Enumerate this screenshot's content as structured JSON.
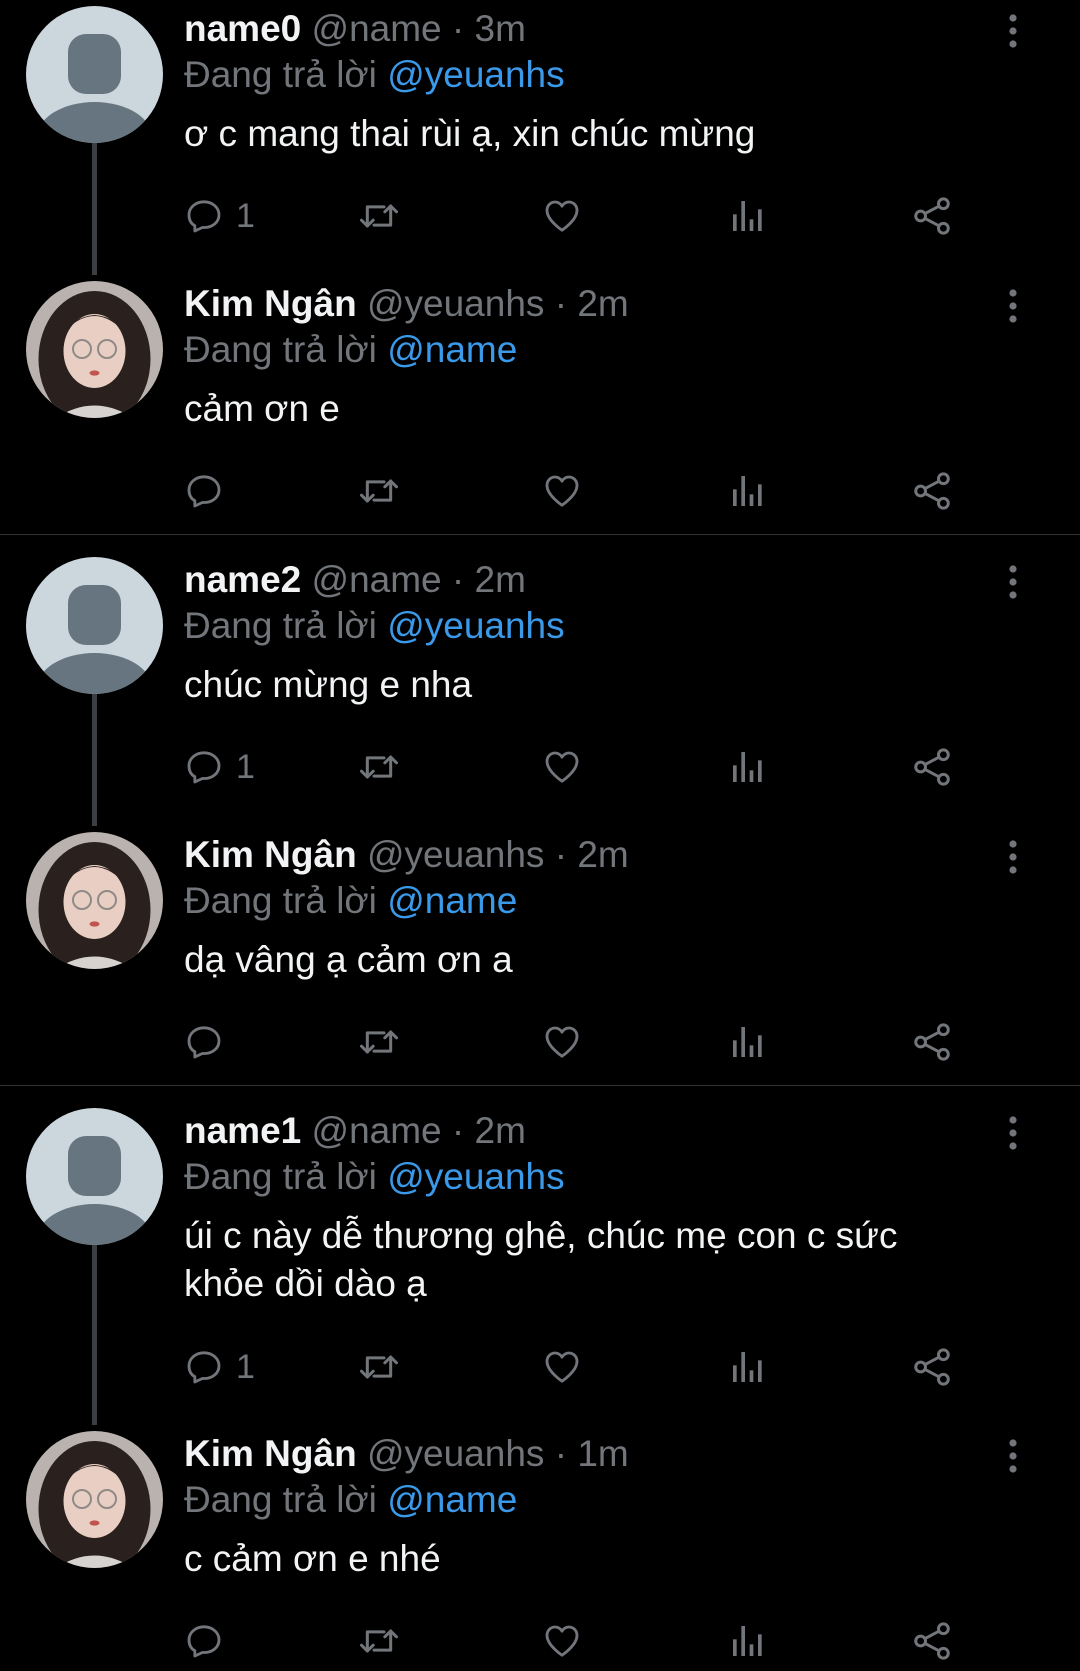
{
  "colors": {
    "background": "#000000",
    "mention": "#3a99e8",
    "muted": "#72767b",
    "divider": "#2f3336"
  },
  "labels": {
    "replying_to": "Đang trả lời"
  },
  "tweets": [
    {
      "name": "name0",
      "handle": "@name",
      "time": "3m",
      "reply_to": "@yeuanhs",
      "text": "ơ c mang thai rùi ạ, xin chúc mừng",
      "reply_count": "1",
      "avatar": "default-avatar-icon"
    },
    {
      "name": "Kim Ngân",
      "handle": "@yeuanhs",
      "time": "2m",
      "reply_to": "@name",
      "text": "cảm ơn e",
      "reply_count": "",
      "avatar": "profile-photo"
    },
    {
      "name": "name2",
      "handle": "@name",
      "time": "2m",
      "reply_to": "@yeuanhs",
      "text": "chúc mừng e nha",
      "reply_count": "1",
      "avatar": "default-avatar-icon"
    },
    {
      "name": "Kim Ngân",
      "handle": "@yeuanhs",
      "time": "2m",
      "reply_to": "@name",
      "text": "dạ vâng ạ cảm ơn a",
      "reply_count": "",
      "avatar": "profile-photo"
    },
    {
      "name": "name1",
      "handle": "@name",
      "time": "2m",
      "reply_to": "@yeuanhs",
      "text": "úi c này dễ thương ghê, chúc mẹ con c sức khỏe dồi dào ạ",
      "reply_count": "1",
      "avatar": "default-avatar-icon"
    },
    {
      "name": "Kim Ngân",
      "handle": "@yeuanhs",
      "time": "1m",
      "reply_to": "@name",
      "text": "c cảm ơn e nhé",
      "reply_count": "",
      "avatar": "profile-photo"
    }
  ]
}
